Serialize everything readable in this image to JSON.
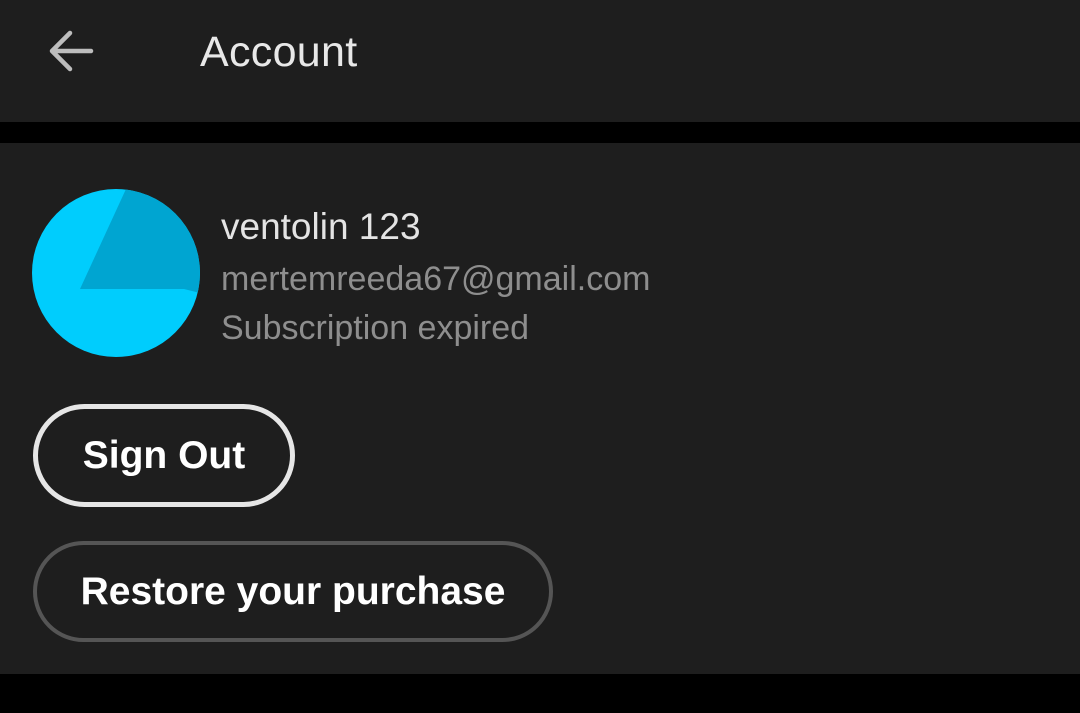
{
  "header": {
    "back_icon": "arrow-left-icon",
    "title": "Account"
  },
  "profile": {
    "avatar_colors": {
      "base": "#00cdfd",
      "shade": "#00a5d1"
    },
    "name": "ventolin 123",
    "email": "mertemreeda67@gmail.com",
    "subscription_status": "Subscription expired"
  },
  "actions": {
    "sign_out_label": "Sign Out",
    "restore_label": "Restore your purchase"
  },
  "colors": {
    "surface": "#1e1e1e",
    "background": "#000000",
    "primary_text": "#e4e4e4",
    "secondary_text": "#8e8e8e"
  }
}
